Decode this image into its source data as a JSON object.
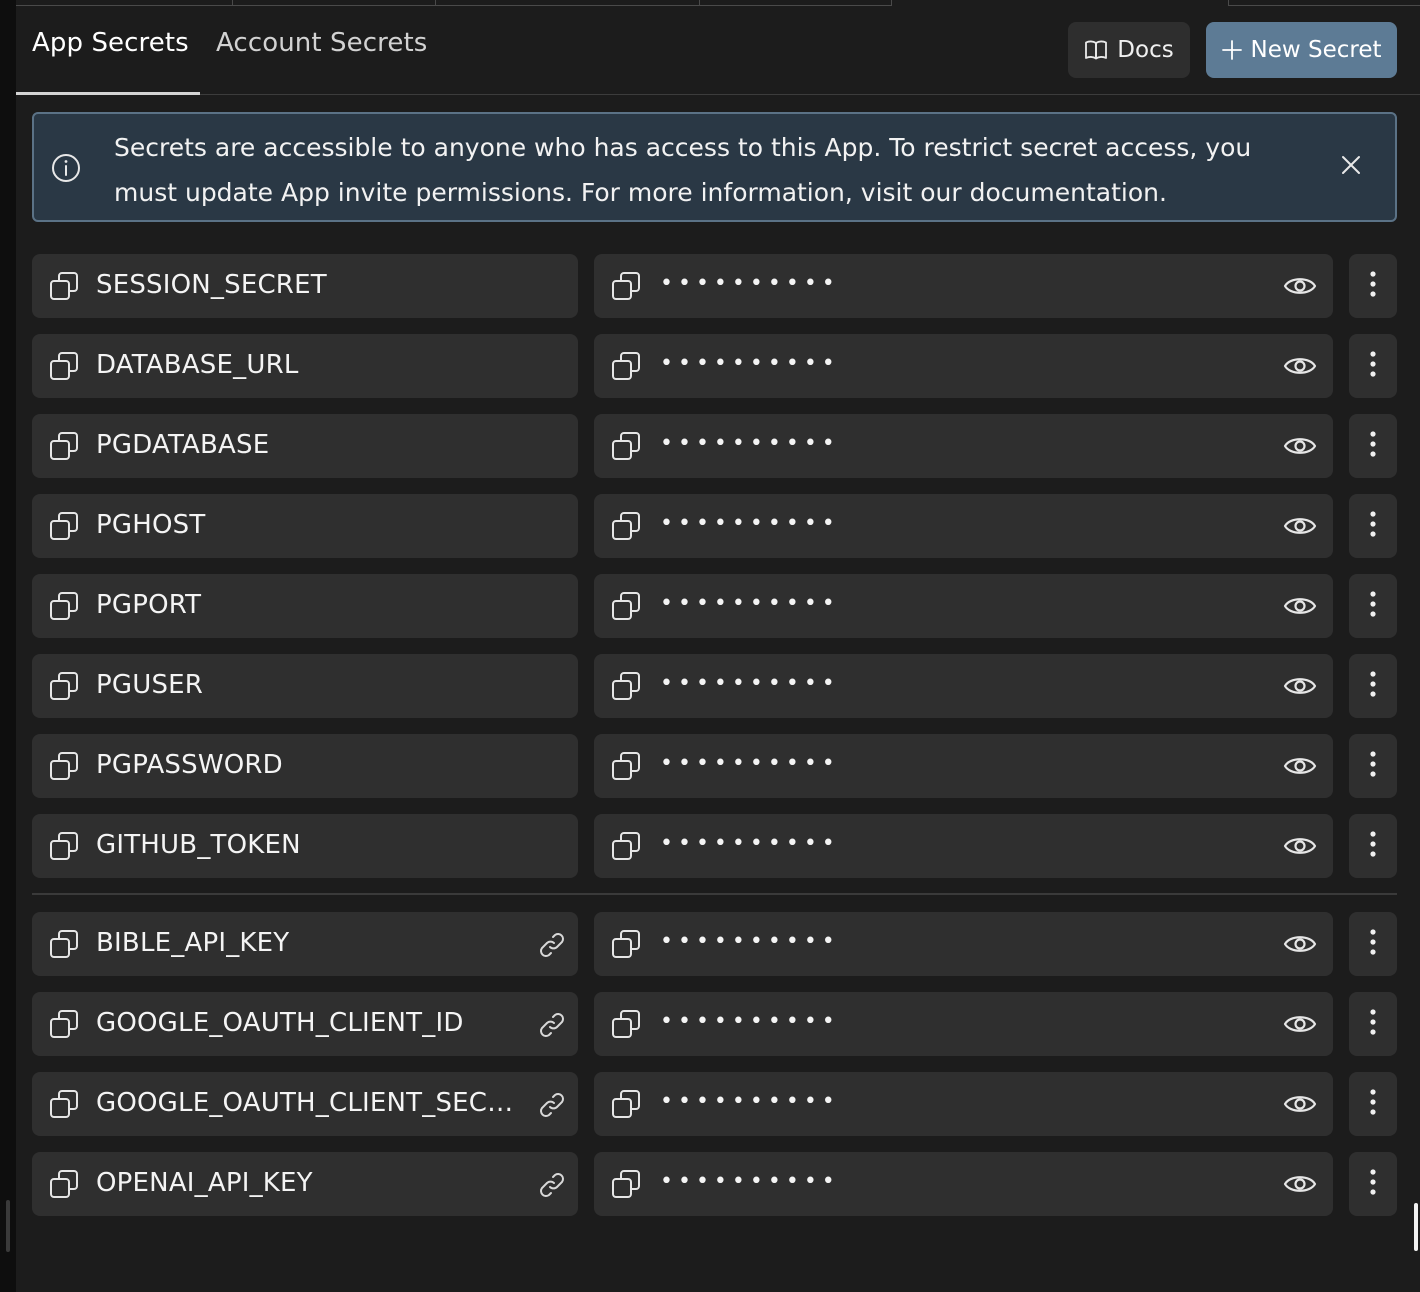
{
  "tabs": [
    {
      "label": "App Secrets",
      "active": true
    },
    {
      "label": "Account Secrets",
      "active": false
    }
  ],
  "actions": {
    "docs_label": "Docs",
    "docs_icon": "book-icon",
    "new_secret_label": "New Secret",
    "new_secret_icon": "plus-icon"
  },
  "banner": {
    "icon": "info-icon",
    "message": "Secrets are accessible to anyone who has access to this App. To restrict secret access, you must update App invite permissions. For more information, visit our documentation."
  },
  "app_secrets": [
    {
      "name": "SESSION_SECRET",
      "value": "••••••••••",
      "linked": false
    },
    {
      "name": "DATABASE_URL",
      "value": "••••••••••",
      "linked": false
    },
    {
      "name": "PGDATABASE",
      "value": "••••••••••",
      "linked": false
    },
    {
      "name": "PGHOST",
      "value": "••••••••••",
      "linked": false
    },
    {
      "name": "PGPORT",
      "value": "••••••••••",
      "linked": false
    },
    {
      "name": "PGUSER",
      "value": "••••••••••",
      "linked": false
    },
    {
      "name": "PGPASSWORD",
      "value": "••••••••••",
      "linked": false
    },
    {
      "name": "GITHUB_TOKEN",
      "value": "••••••••••",
      "linked": false
    }
  ],
  "linked_secrets": [
    {
      "name": "BIBLE_API_KEY",
      "value": "••••••••••",
      "linked": true
    },
    {
      "name": "GOOGLE_OAUTH_CLIENT_ID",
      "value": "••••••••••",
      "linked": true
    },
    {
      "name": "GOOGLE_OAUTH_CLIENT_SECRET",
      "value": "••••••••••",
      "linked": true
    },
    {
      "name": "OPENAI_API_KEY",
      "value": "••••••••••",
      "linked": true
    }
  ],
  "colors": {
    "panel_bg": "#1c1c1c",
    "row_bg": "#2f2f2f",
    "accent_button": "#5d7b95",
    "banner_bg": "#2a3845",
    "banner_border": "#5b7286"
  }
}
